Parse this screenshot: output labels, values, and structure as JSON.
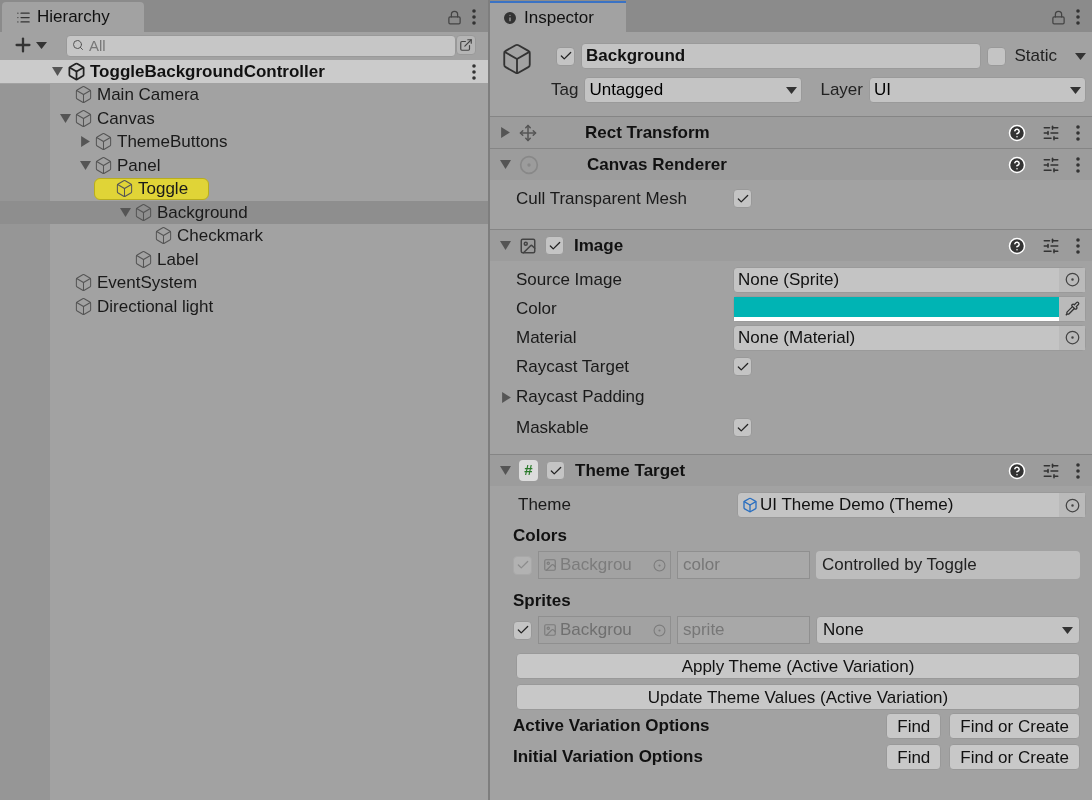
{
  "hierarchy": {
    "title": "Hierarchy",
    "search": {
      "placeholder": "All"
    },
    "scene": {
      "name": "ToggleBackgroundController",
      "expanded": true,
      "children": [
        {
          "name": "Main Camera",
          "selected": false,
          "highlighted": false
        },
        {
          "name": "Canvas",
          "expanded": true,
          "selected": false,
          "highlighted": false,
          "children": [
            {
              "name": "ThemeButtons",
              "expanded": false,
              "selected": false,
              "highlighted": false
            },
            {
              "name": "Panel",
              "expanded": true,
              "selected": false,
              "highlighted": false,
              "children": [
                {
                  "name": "Toggle",
                  "expanded": true,
                  "selected": false,
                  "highlighted": true,
                  "children": [
                    {
                      "name": "Background",
                      "expanded": true,
                      "selected": true,
                      "highlighted": false,
                      "children": [
                        {
                          "name": "Checkmark",
                          "selected": false,
                          "highlighted": false
                        }
                      ]
                    },
                    {
                      "name": "Label",
                      "selected": false,
                      "highlighted": false
                    }
                  ]
                }
              ]
            }
          ]
        },
        {
          "name": "EventSystem",
          "selected": false,
          "highlighted": false
        },
        {
          "name": "Directional light",
          "selected": false,
          "highlighted": false
        }
      ]
    }
  },
  "inspector": {
    "title": "Inspector",
    "object": {
      "active": true,
      "name": "Background",
      "static": false,
      "static_label": "Static",
      "tag_label": "Tag",
      "tag": "Untagged",
      "layer_label": "Layer",
      "layer": "UI"
    },
    "components": [
      {
        "kind": "rect",
        "title": "Rect Transform",
        "expanded": false
      },
      {
        "kind": "canvas",
        "title": "Canvas Renderer",
        "expanded": true,
        "properties": [
          {
            "kind": "checkbox",
            "label": "Cull Transparent Mesh",
            "checked": true
          }
        ]
      },
      {
        "kind": "image",
        "title": "Image",
        "expanded": true,
        "enabled": true,
        "properties": [
          {
            "kind": "object",
            "label": "Source Image",
            "value": "None (Sprite)"
          },
          {
            "kind": "color",
            "label": "Color",
            "color": "#00b4b4"
          },
          {
            "kind": "object",
            "label": "Material",
            "value": "None (Material)"
          },
          {
            "kind": "checkbox",
            "label": "Raycast Target",
            "checked": true
          },
          {
            "kind": "foldout",
            "label": "Raycast Padding",
            "expanded": false
          },
          {
            "kind": "checkbox",
            "label": "Maskable",
            "checked": true
          }
        ]
      },
      {
        "kind": "script",
        "title": "Theme Target",
        "expanded": true,
        "enabled": true,
        "icon_text": "#",
        "theme": {
          "label": "Theme",
          "value": "UI Theme Demo (Theme)"
        },
        "sections": [
          {
            "title": "Colors",
            "checked": true,
            "disabled": true,
            "target": "Backgrou",
            "property": "color",
            "kind": "text",
            "value": "Controlled by Toggle"
          },
          {
            "title": "Sprites",
            "checked": true,
            "disabled": false,
            "target": "Backgrou",
            "property": "sprite",
            "kind": "dropdown",
            "value": "None"
          }
        ],
        "buttons": [
          "Apply Theme (Active Variation)",
          "Update Theme Values (Active Variation)"
        ],
        "options": [
          {
            "label": "Active Variation Options",
            "buttons": [
              "Find",
              "Find or Create"
            ]
          },
          {
            "label": "Initial Variation Options",
            "buttons": [
              "Find",
              "Find or Create"
            ]
          }
        ]
      }
    ]
  }
}
